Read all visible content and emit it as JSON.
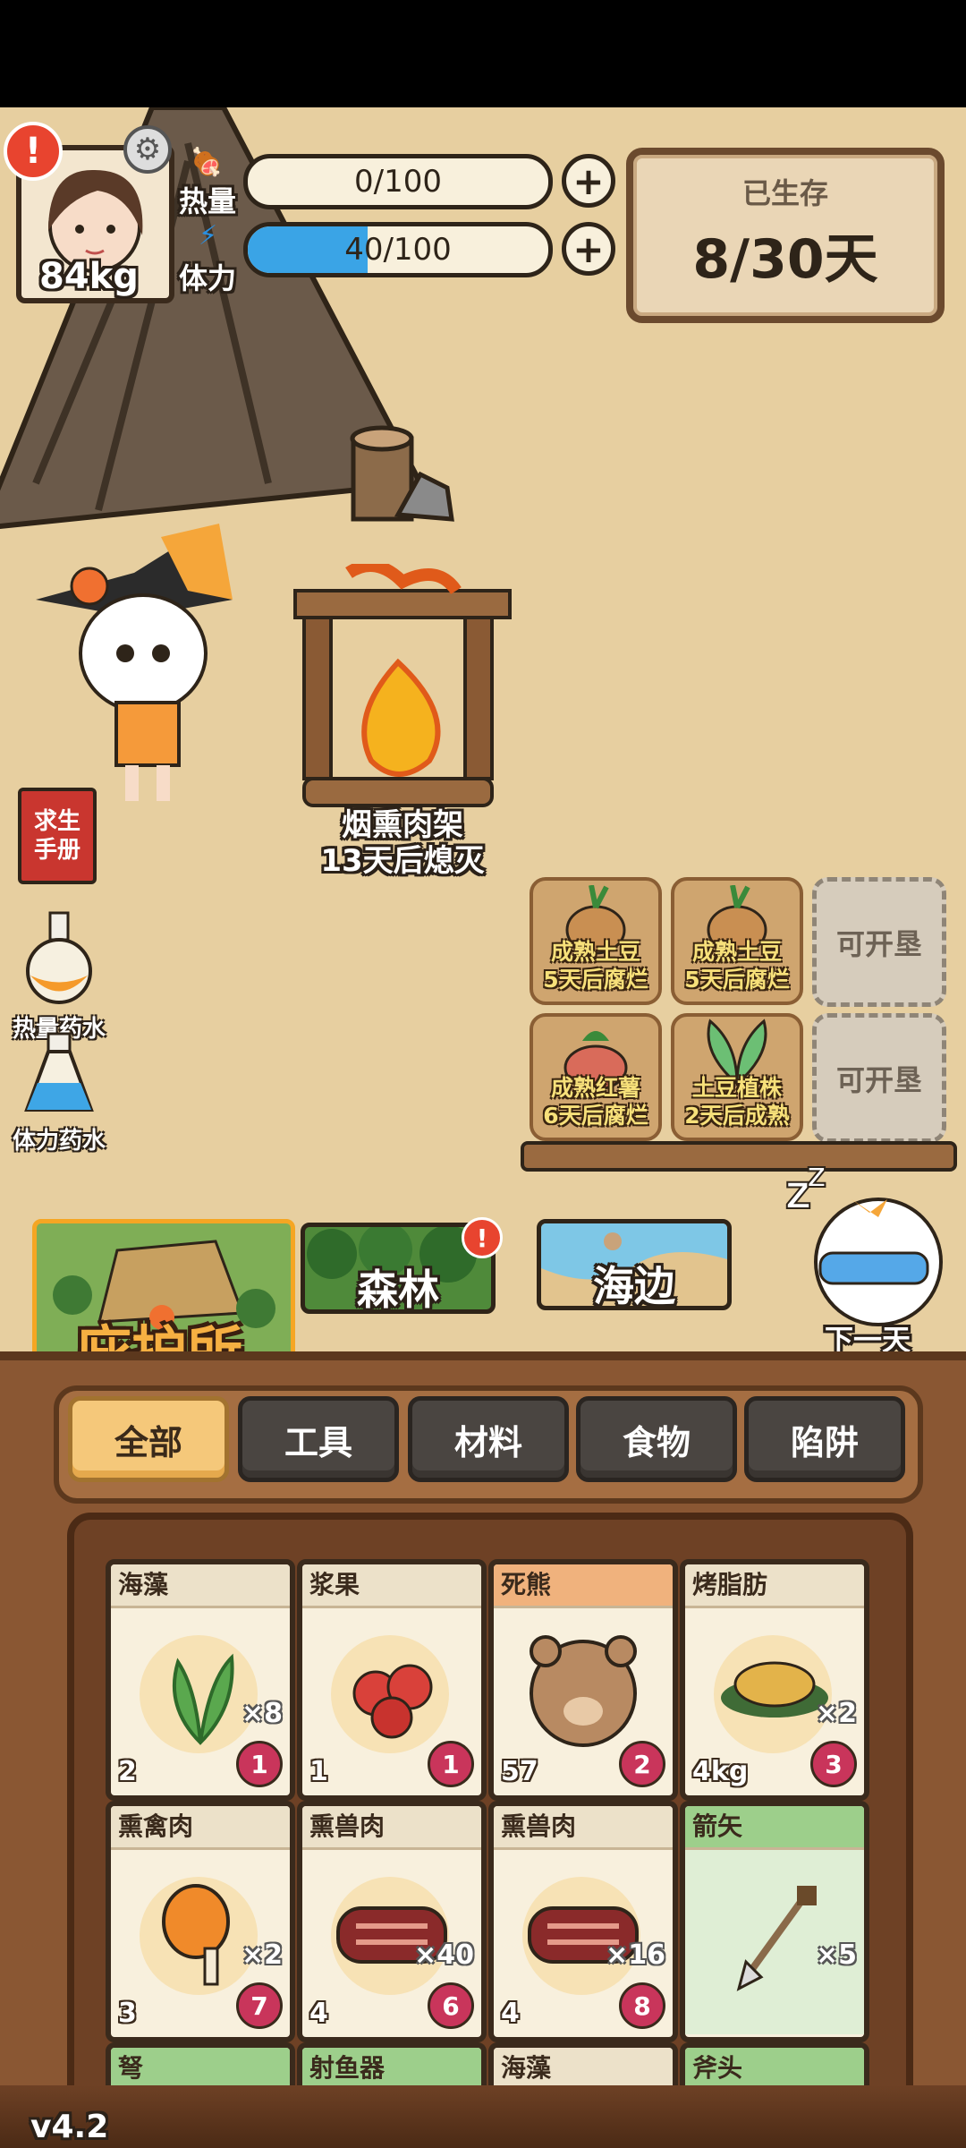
{
  "hud": {
    "weight": "84kg",
    "heat_label": "热量",
    "heat_value": "0/100",
    "heat_fraction": 0.0,
    "stamina_label": "体力",
    "stamina_value": "40/100",
    "stamina_fraction": 0.4,
    "survived_label": "已生存",
    "survived_value": "8/30天"
  },
  "camp": {
    "smoker_name": "烟熏肉架",
    "smoker_status": "13天后熄灭"
  },
  "sidebar": {
    "manual_label": "求生手册",
    "heat_potion_label": "热量药水",
    "stamina_potion_label": "体力药水"
  },
  "plots": [
    {
      "line1": "成熟土豆",
      "line2": "5天后腐烂"
    },
    {
      "line1": "成熟土豆",
      "line2": "5天后腐烂"
    },
    {
      "empty_label": "可开垦"
    },
    {
      "line1": "成熟红薯",
      "line2": "6天后腐烂"
    },
    {
      "line1": "土豆植株",
      "line2": "2天后成熟"
    },
    {
      "empty_label": "可开垦"
    }
  ],
  "locations": {
    "shelter": "庇护所",
    "forest": "森林",
    "seaside": "海边",
    "next_day": "下一天"
  },
  "categories": [
    "全部",
    "工具",
    "材料",
    "食物",
    "陷阱"
  ],
  "items": [
    {
      "name": "海藻",
      "count": "×8",
      "weight": "2",
      "badge": "1",
      "icon": "seaweed-icon"
    },
    {
      "name": "浆果",
      "count": "",
      "weight": "1",
      "badge": "1",
      "icon": "berry-icon"
    },
    {
      "name": "死熊",
      "count": "",
      "weight": "57",
      "badge": "2",
      "icon": "bear-icon"
    },
    {
      "name": "烤脂肪",
      "count": "×2",
      "weight": "4kg",
      "badge": "3",
      "icon": "roasted-fat-icon"
    },
    {
      "name": "熏禽肉",
      "count": "×2",
      "weight": "3",
      "badge": "7",
      "icon": "drumstick-icon"
    },
    {
      "name": "熏兽肉",
      "count": "×40",
      "weight": "4",
      "badge": "6",
      "icon": "smoked-meat-icon"
    },
    {
      "name": "熏兽肉",
      "count": "×16",
      "weight": "4",
      "badge": "8",
      "icon": "smoked-meat-icon"
    },
    {
      "name": "箭矢",
      "count": "×5",
      "weight": "",
      "badge": "",
      "icon": "arrow-icon"
    }
  ],
  "partial_row": [
    "弩",
    "射鱼器",
    "海藻",
    "斧头"
  ],
  "version": "v4.2"
}
